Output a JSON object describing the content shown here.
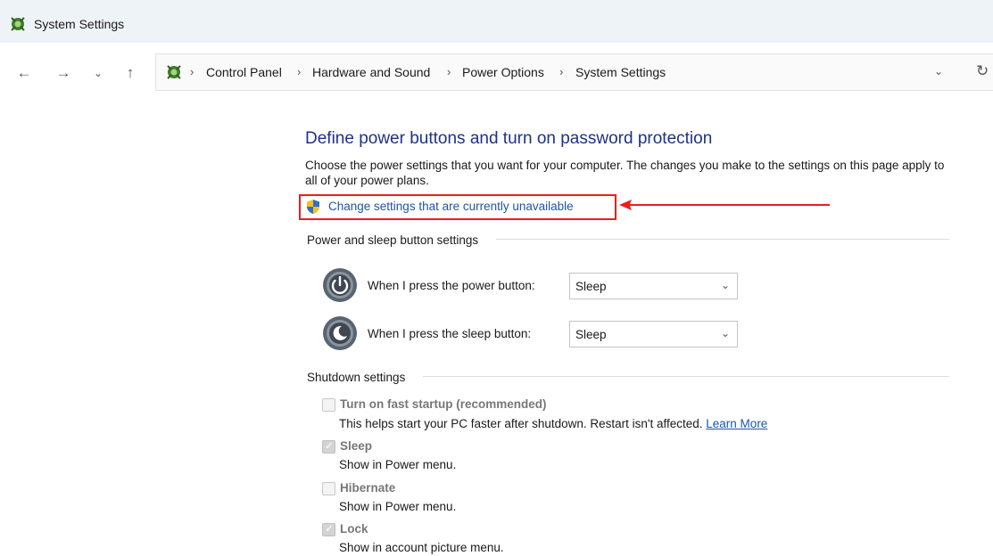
{
  "window": {
    "title": "System Settings",
    "app_icon": "control-panel-icon"
  },
  "nav": {
    "back_icon": "←",
    "forward_icon": "→",
    "recent_icon": "⌄",
    "up_icon": "↑",
    "address_chevron": "⌄",
    "refresh_icon": "↻"
  },
  "breadcrumb": [
    {
      "label": "Control Panel"
    },
    {
      "label": "Hardware and Sound"
    },
    {
      "label": "Power Options"
    },
    {
      "label": "System Settings"
    }
  ],
  "page": {
    "title": "Define power buttons and turn on password protection",
    "description": "Choose the power settings that you want for your computer. The changes you make to the settings on this page apply to all of your power plans.",
    "change_link": "Change settings that are currently unavailable"
  },
  "power_sleep": {
    "heading": "Power and sleep button settings",
    "power_button": {
      "label": "When I press the power button:",
      "value": "Sleep"
    },
    "sleep_button": {
      "label": "When I press the sleep button:",
      "value": "Sleep"
    }
  },
  "shutdown": {
    "heading": "Shutdown settings",
    "fast_startup": {
      "label": "Turn on fast startup (recommended)",
      "description": "This helps start your PC faster after shutdown. Restart isn't affected.",
      "link": "Learn More",
      "checked": false
    },
    "sleep": {
      "label": "Sleep",
      "description": "Show in Power menu.",
      "checked": true
    },
    "hibernate": {
      "label": "Hibernate",
      "description": "Show in Power menu.",
      "checked": false
    },
    "lock": {
      "label": "Lock",
      "description": "Show in account picture menu.",
      "checked": true
    }
  },
  "colors": {
    "title_blue": "#1e3287",
    "link_blue": "#1e55a8",
    "highlight_red": "#e8201d",
    "titlebar_bg": "#eef3f8"
  }
}
